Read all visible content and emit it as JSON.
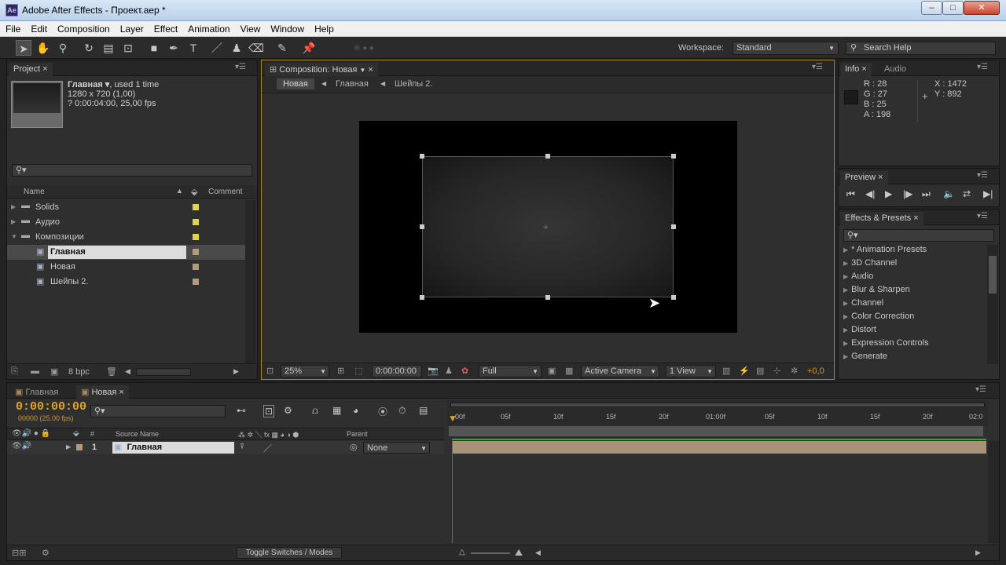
{
  "window": {
    "title": "Adobe After Effects - Проект.aep *",
    "app_icon": "Ae"
  },
  "menu": [
    "File",
    "Edit",
    "Composition",
    "Layer",
    "Effect",
    "Animation",
    "View",
    "Window",
    "Help"
  ],
  "toolbar": {
    "workspace_label": "Workspace:",
    "workspace_value": "Standard",
    "search_placeholder": "Search Help"
  },
  "project": {
    "tab": "Project",
    "item_name": "Главная ▾",
    "item_used": ", used 1 time",
    "item_size": "1280 x 720 (1,00)",
    "item_duration": "? 0:00:04:00, 25,00 fps",
    "col_name": "Name",
    "col_comment": "Comment",
    "items": [
      {
        "name": "Solids",
        "type": "folder",
        "color": "#e3d34a"
      },
      {
        "name": "Аудио",
        "type": "folder",
        "color": "#e3d34a"
      },
      {
        "name": "Композиции",
        "type": "folder-open",
        "color": "#e3d34a"
      },
      {
        "name": "Главная",
        "type": "comp",
        "color": "#b39a7a",
        "selected": true
      },
      {
        "name": "Новая",
        "type": "comp",
        "color": "#b39a7a"
      },
      {
        "name": "Шейпы 2.",
        "type": "comp",
        "color": "#b39a7a"
      }
    ],
    "bpc": "8 bpc"
  },
  "composition": {
    "tab": "Composition: Новая",
    "breadcrumbs": [
      "Новая",
      "Главная",
      "Шейпы 2."
    ],
    "zoom": "25%",
    "timecode": "0:00:00:00",
    "quality": "Full",
    "camera": "Active Camera",
    "views": "1 View",
    "exposure": "+0,0"
  },
  "info": {
    "tab_info": "Info",
    "tab_audio": "Audio",
    "r": "R : 28",
    "g": "G : 27",
    "b": "B : 25",
    "a": "A : 198",
    "x": "X : 1472",
    "y": "Y : 892"
  },
  "preview": {
    "tab": "Preview"
  },
  "effects": {
    "tab": "Effects & Presets",
    "items": [
      "* Animation Presets",
      "3D Channel",
      "Audio",
      "Blur & Sharpen",
      "Channel",
      "Color Correction",
      "Distort",
      "Expression Controls",
      "Generate"
    ]
  },
  "timeline": {
    "tabs": [
      "Главная",
      "Новая"
    ],
    "timecode": "0:00:00:00",
    "frames": "00000 (25.00 fps)",
    "col_source": "Source Name",
    "col_parent": "Parent",
    "col_num": "#",
    "ruler": [
      "00f",
      "05f",
      "10f",
      "15f",
      "20f",
      "01:00f",
      "05f",
      "10f",
      "15f",
      "20f",
      "02:0"
    ],
    "layer": {
      "num": "1",
      "name": "Главная",
      "parent": "None"
    },
    "toggle_label": "Toggle Switches / Modes"
  }
}
